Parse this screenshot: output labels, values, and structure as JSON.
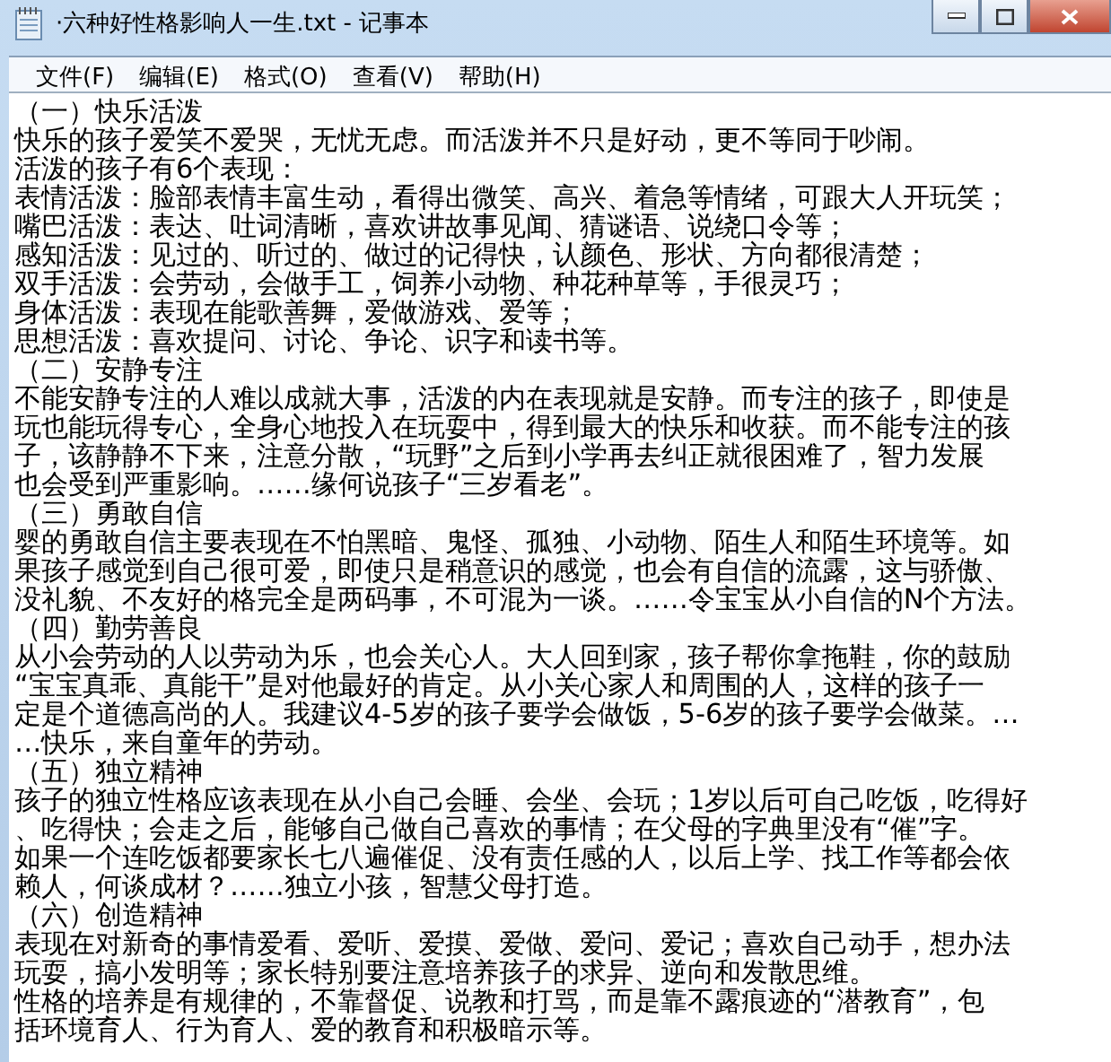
{
  "window": {
    "title": "·六种好性格影响人一生.txt - 记事本"
  },
  "menu": [
    "文件(F)",
    "编辑(E)",
    "格式(O)",
    "查看(V)",
    "帮助(H)"
  ],
  "lines": [
    "（一）快乐活泼",
    "快乐的孩子爱笑不爱哭，无忧无虑。而活泼并不只是好动，更不等同于吵闹。",
    "活泼的孩子有6个表现：",
    "表情活泼：脸部表情丰富生动，看得出微笑、高兴、着急等情绪，可跟大人开玩笑；",
    "嘴巴活泼：表达、吐词清晰，喜欢讲故事见闻、猜谜语、说绕口令等；",
    "感知活泼：见过的、听过的、做过的记得快，认颜色、形状、方向都很清楚；",
    "双手活泼：会劳动，会做手工，饲养小动物、种花种草等，手很灵巧；",
    "身体活泼：表现在能歌善舞，爱做游戏、爱等；",
    "思想活泼：喜欢提问、讨论、争论、识字和读书等。",
    "（二）安静专注",
    "不能安静专注的人难以成就大事，活泼的内在表现就是安静。而专注的孩子，即使是",
    "玩也能玩得专心，全身心地投入在玩耍中，得到最大的快乐和收获。而不能专注的孩",
    "子，该静静不下来，注意分散，“玩野”之后到小学再去纠正就很困难了，智力发展",
    "也会受到严重影响。……缘何说孩子“三岁看老”。",
    "（三）勇敢自信",
    "婴的勇敢自信主要表现在不怕黑暗、鬼怪、孤独、小动物、陌生人和陌生环境等。如",
    "果孩子感觉到自己很可爱，即使只是稍意识的感觉，也会有自信的流露，这与骄傲、",
    "没礼貌、不友好的格完全是两码事，不可混为一谈。……令宝宝从小自信的N个方法。",
    "（四）勤劳善良",
    "从小会劳动的人以劳动为乐，也会关心人。大人回到家，孩子帮你拿拖鞋，你的鼓励",
    "“宝宝真乖、真能干”是对他最好的肯定。从小关心家人和周围的人，这样的孩子一",
    "定是个道德高尚的人。我建议4-5岁的孩子要学会做饭，5-6岁的孩子要学会做菜。…",
    "…快乐，来自童年的劳动。",
    "（五）独立精神",
    "孩子的独立性格应该表现在从小自己会睡、会坐、会玩；1岁以后可自己吃饭，吃得好",
    "、吃得快；会走之后，能够自己做自己喜欢的事情；在父母的字典里没有“催”字。",
    "如果一个连吃饭都要家长七八遍催促、没有责任感的人，以后上学、找工作等都会依",
    "赖人，何谈成材？……独立小孩，智慧父母打造。",
    "（六）创造精神",
    "表现在对新奇的事情爱看、爱听、爱摸、爱做、爱问、爱记；喜欢自己动手，想办法",
    "玩耍，搞小发明等；家长特别要注意培养孩子的求异、逆向和发散思维。",
    "性格的培养是有规律的，不靠督促、说教和打骂，而是靠不露痕迹的“潜教育”，包",
    "括环境育人、行为育人、爱的教育和积极暗示等。"
  ]
}
